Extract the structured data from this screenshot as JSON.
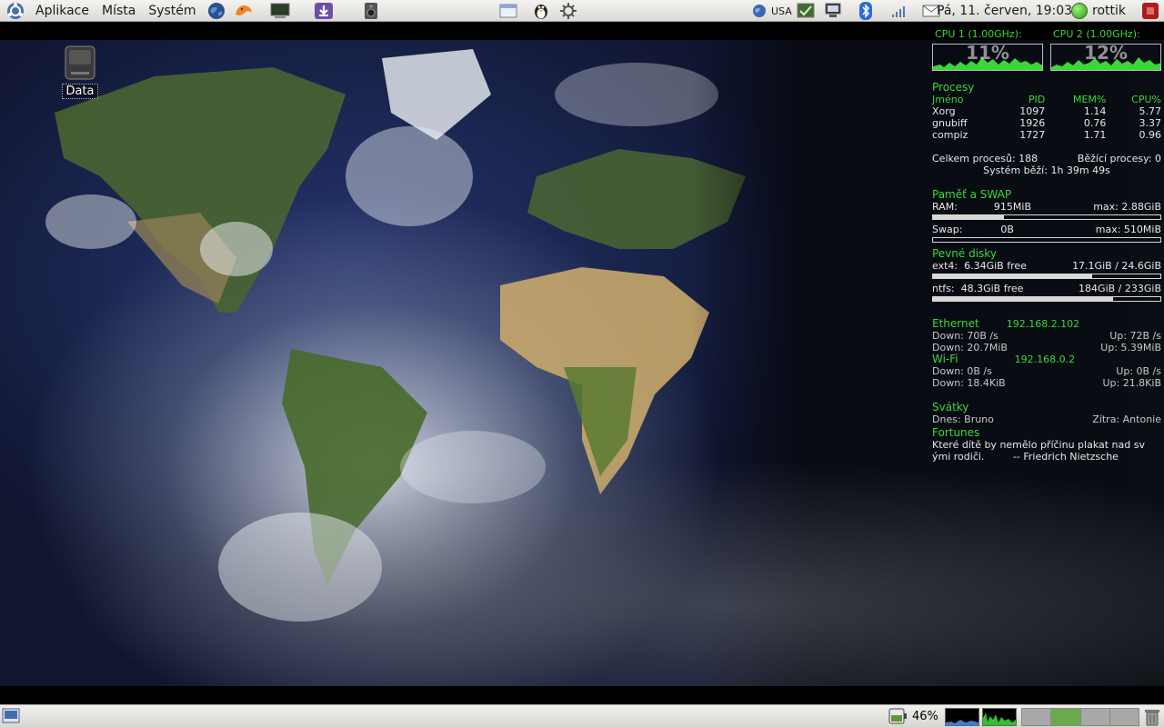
{
  "top_panel": {
    "menus": [
      "Aplikace",
      "Místa",
      "Systém"
    ],
    "keyboard_layout": "USA",
    "clock": "Pá, 11. červen, 19:03",
    "user": "rottik"
  },
  "desktop": {
    "icons": [
      {
        "label": "Data",
        "icon": "drive-icon"
      }
    ]
  },
  "conky": {
    "cpu": [
      {
        "label": "CPU 1 (1.00GHz):",
        "percent": "11%"
      },
      {
        "label": "CPU 2 (1.00GHz):",
        "percent": "12%"
      }
    ],
    "processes": {
      "title": "Procesy",
      "headers": [
        "Jméno",
        "PID",
        "MEM%",
        "CPU%"
      ],
      "rows": [
        [
          "Xorg",
          "1097",
          "1.14",
          "5.77"
        ],
        [
          "gnubiff",
          "1926",
          "0.76",
          "3.37"
        ],
        [
          "compiz",
          "1727",
          "1.71",
          "0.96"
        ]
      ],
      "total": "Celkem procesů: 188",
      "running": "Běžící procesy: 0",
      "uptime": "Systém běží: 1h 39m 49s"
    },
    "memory": {
      "title": "Paměť a SWAP",
      "ram_label": "RAM:",
      "ram_value": "915MiB",
      "ram_max": "max: 2.88GiB",
      "ram_fraction": 0.31,
      "swap_label": "Swap:",
      "swap_value": "0B",
      "swap_max": "max: 510MiB",
      "swap_fraction": 0
    },
    "disks": {
      "title": "Pevné disky",
      "items": [
        {
          "name": "ext4:",
          "free": "6.34GiB free",
          "usage": "17.1GiB / 24.6GiB",
          "fraction": 0.7
        },
        {
          "name": "ntfs:",
          "free": "48.3GiB free",
          "usage": "184GiB / 233GiB",
          "fraction": 0.79
        }
      ]
    },
    "network": {
      "ethernet": {
        "title": "Ethernet",
        "ip": "192.168.2.102",
        "down_rate": "Down:  70B  /s",
        "up_rate": "Up: 72B  /s",
        "down_total": "Down: 20.7MiB",
        "up_total": "Up:   5.39MiB"
      },
      "wifi": {
        "title": "Wi-Fi",
        "ip": "192.168.0.2",
        "down_rate": "Down:  0B  /s",
        "up_rate": "Up: 0B  /s",
        "down_total": "Down: 18.4KiB",
        "up_total": "Up:   21.8KiB"
      }
    },
    "holidays": {
      "title": "Svátky",
      "today": "Dnes: Bruno",
      "tomorrow": "Zítra: Antonie"
    },
    "fortunes": {
      "title": "Fortunes",
      "line1": "Které dítě by nemělo příčinu plakat nad sv",
      "line2": "ými rodiči.         -- Friedrich Nietzsche"
    }
  },
  "bottom_panel": {
    "battery": "46%",
    "workspaces": 4,
    "active_workspace": 2
  }
}
